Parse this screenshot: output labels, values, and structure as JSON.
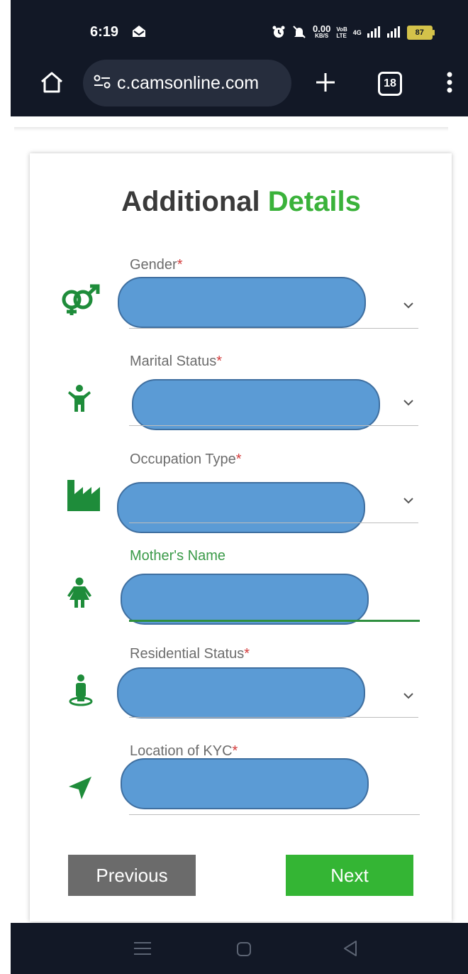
{
  "status_bar": {
    "time": "6:19",
    "net_speed_value": "0.00",
    "net_speed_unit": "KB/S",
    "volte_top": "VoB",
    "volte_bottom": "LTE",
    "network": "4G",
    "battery": "87"
  },
  "browser": {
    "url": "c.camsonline.com",
    "tab_count": "18"
  },
  "form": {
    "title_main": "Additional",
    "title_accent": "Details",
    "fields": [
      {
        "label": "Gender",
        "required_mark": "*",
        "icon": "gender-icon"
      },
      {
        "label": "Marital Status",
        "required_mark": "*",
        "icon": "person-icon"
      },
      {
        "label": "Occupation Type",
        "required_mark": "*",
        "icon": "factory-icon"
      },
      {
        "label": "Mother's Name",
        "required_mark": "",
        "icon": "woman-icon"
      },
      {
        "label": "Residential Status",
        "required_mark": "*",
        "icon": "resident-icon"
      },
      {
        "label": "Location of KYC",
        "required_mark": "*",
        "icon": "navigation-arrow-icon"
      }
    ],
    "previous_label": "Previous",
    "next_label": "Next"
  },
  "colors": {
    "accent_green": "#3ab23a",
    "icon_green": "#1e8c3a",
    "redaction_blue": "#5b9bd5",
    "previous_gray": "#6b6b6b",
    "next_green": "#34b534"
  }
}
